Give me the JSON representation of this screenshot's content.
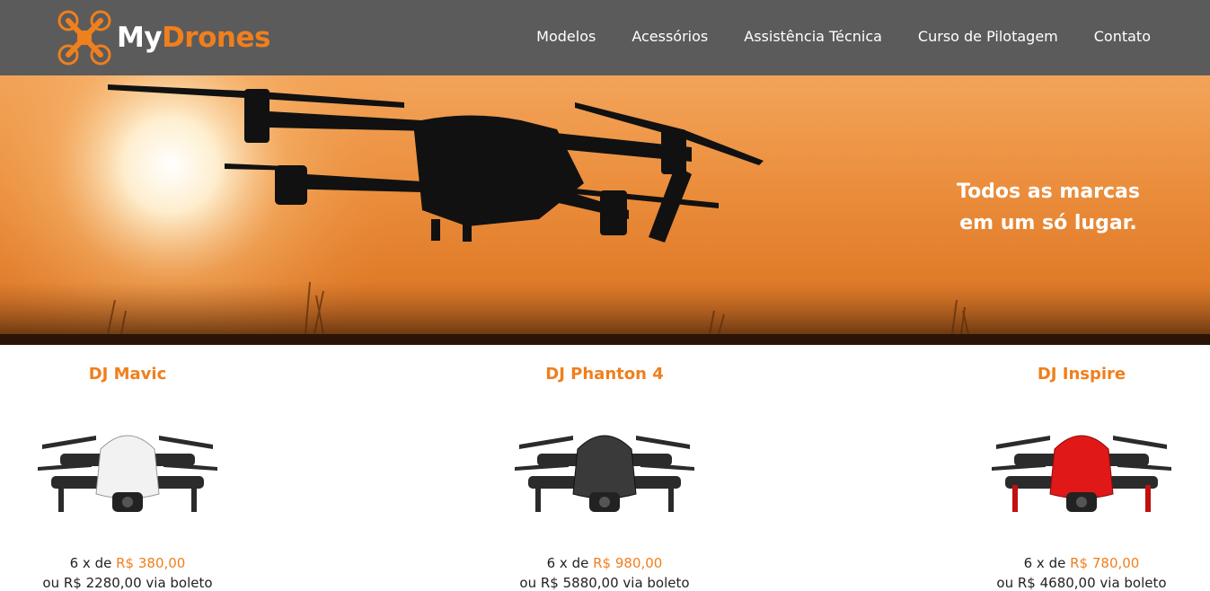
{
  "brand": {
    "my": "My",
    "drones": "Drones"
  },
  "nav": [
    {
      "label": "Modelos"
    },
    {
      "label": "Acessórios"
    },
    {
      "label": "Assistência Técnica"
    },
    {
      "label": "Curso de Pilotagem"
    },
    {
      "label": "Contato"
    }
  ],
  "hero": {
    "line1": "Todos as marcas",
    "line2": "em um só lugar."
  },
  "colors": {
    "accent": "#f07f1d",
    "header": "#5b5b5b"
  },
  "products": [
    {
      "name": "DJ Mavic",
      "installments": "6 x de",
      "installment_price": "R$ 380,00",
      "boleto": "ou R$ 2280,00 via boleto",
      "body_color": "#f2f2f2"
    },
    {
      "name": "DJ Phanton 4",
      "installments": "6 x de",
      "installment_price": "R$ 980,00",
      "boleto": "ou R$ 5880,00 via boleto",
      "body_color": "#3a3a3a"
    },
    {
      "name": "DJ Inspire",
      "installments": "6 x de",
      "installment_price": "R$ 780,00",
      "boleto": "ou R$ 4680,00 via boleto",
      "body_color": "#e01818"
    }
  ]
}
